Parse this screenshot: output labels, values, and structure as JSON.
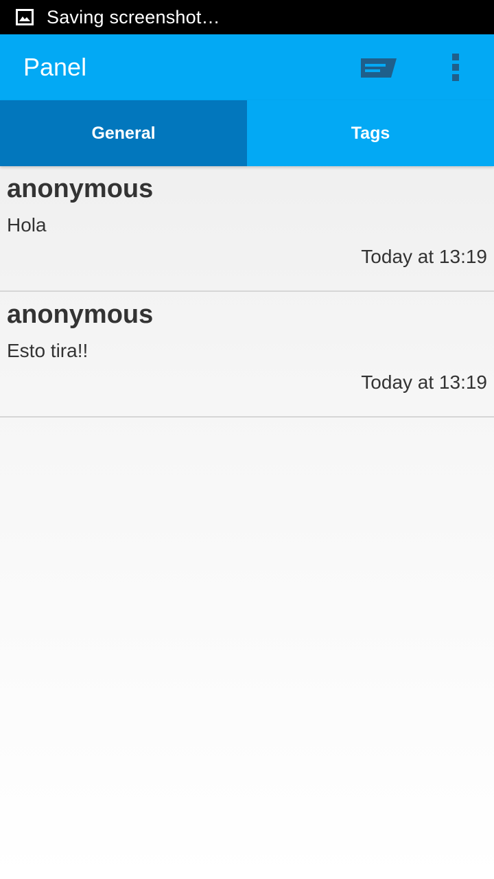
{
  "status_bar": {
    "notification_icon": "image-icon",
    "notification_text": "Saving screenshot…"
  },
  "app_bar": {
    "title": "Panel",
    "actions": [
      "chat-icon",
      "overflow-menu-icon"
    ],
    "accent_color": "#03a9f4"
  },
  "tabs": [
    {
      "label": "General",
      "active": true
    },
    {
      "label": "Tags",
      "active": false
    }
  ],
  "messages": [
    {
      "author": "anonymous",
      "text": "Hola",
      "time": "Today at 13:19"
    },
    {
      "author": "anonymous",
      "text": "Esto tira!!",
      "time": "Today at 13:19"
    }
  ],
  "colors": {
    "primary": "#03a9f4",
    "tab_active": "#0277bd",
    "text": "#333333"
  }
}
